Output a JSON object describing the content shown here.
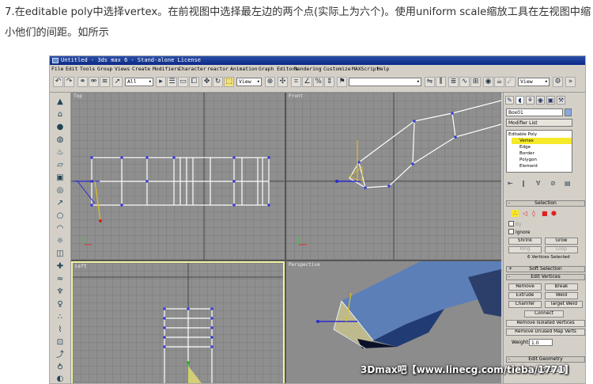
{
  "article": {
    "line1": "7.在editable poly中选择vertex。在前视图中选择最左边的两个点(实际上为六个)。使用uniform scale缩放工具在左视图中缩",
    "line2": "小他们的间距。如所示"
  },
  "app": {
    "title": "Untitled - 3ds max 6 - Stand-alone License",
    "menu": [
      "File",
      "Edit",
      "Tools",
      "Group",
      "Views",
      "Create",
      "Modifiers",
      "Character",
      "reactor",
      "Animation",
      "Graph Editors",
      "Rendering",
      "Customize",
      "MAXScript",
      "Help"
    ],
    "toolbar": {
      "selection_filter": "All",
      "ref_coord": "View",
      "named_selection": "",
      "ref_coord_right": "View"
    }
  },
  "viewports": {
    "top": "Top",
    "front": "Front",
    "left": "Left",
    "perspective": "Perspective"
  },
  "command_panel": {
    "object_name": "Box01",
    "modifier_list": "Modifier List",
    "stack": [
      "Editable Poly",
      "Vertex",
      "Edge",
      "Border",
      "Polygon",
      "Element"
    ],
    "selected_stack_item": "Vertex",
    "selection": {
      "title": "Selection",
      "by_label": "By",
      "ignore_label": "Ignore",
      "shrink": "Shrink",
      "grow": "Grow",
      "ring": "Ring",
      "loop": "Loop",
      "status": "6 Vertices Selected"
    },
    "soft_selection": "Soft Selection",
    "edit_vertices": {
      "title": "Edit Vertices",
      "remove": "Remove",
      "break": "Break",
      "extrude": "Extrude",
      "weld": "Weld",
      "chamfer": "Chamfer",
      "target_weld": "Target Weld",
      "connect": "Connect",
      "remove_isolated": "Remove Isolated Vertices",
      "remove_unused": "Remove Unused Map Verts",
      "weight_label": "Weight:",
      "weight_value": "1.0"
    },
    "edit_geometry": {
      "title": "Edit Geometry",
      "constraints_label": "Constraints:",
      "constraints_value": "None"
    }
  },
  "watermark": "3Dmax吧【www.linecg.com/tieba/1771】"
}
